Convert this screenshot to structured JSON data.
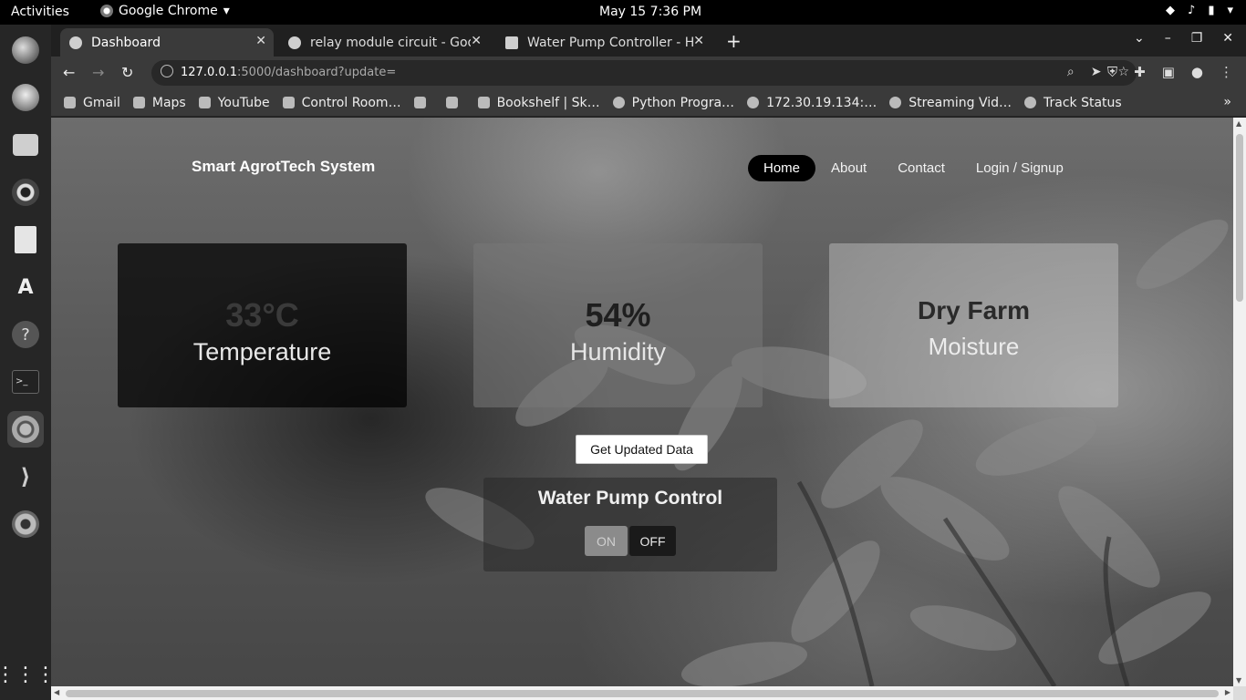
{
  "topbar": {
    "activities": "Activities",
    "app_name": "Google Chrome",
    "datetime": "May 15  7:36 PM"
  },
  "dock": {
    "items": [
      "firefox-icon",
      "thunderbird-icon",
      "files-icon",
      "rhythmbox-icon",
      "writer-icon",
      "software-icon",
      "help-icon",
      "terminal-icon",
      "chrome-icon",
      "vscode-icon",
      "settings-icon",
      "apps-grid-icon"
    ]
  },
  "tabs": [
    {
      "title": "Dashboard",
      "active": true
    },
    {
      "title": "relay module circuit - Goog",
      "active": false
    },
    {
      "title": "Water Pump Controller - H",
      "active": false
    }
  ],
  "address": {
    "host": "127.0.0.1",
    "path": ":5000/dashboard?update="
  },
  "bookmarks": [
    "Gmail",
    "Maps",
    "YouTube",
    "Control Room…",
    "",
    "",
    "Bookshelf | Sk…",
    "Python Progra…",
    "172.30.19.134:…",
    "Streaming Vid…",
    "Track Status"
  ],
  "page": {
    "brand": "Smart AgrotTech System",
    "nav": [
      "Home",
      "About",
      "Contact",
      "Login / Signup"
    ],
    "temperature": {
      "value": "33°C",
      "label": "Temperature"
    },
    "humidity": {
      "value": "54%",
      "label": "Humidity"
    },
    "moisture": {
      "value": "Dry Farm",
      "label": "Moisture"
    },
    "update_button": "Get Updated Data",
    "pump": {
      "title": "Water Pump Control",
      "on": "ON",
      "off": "OFF"
    }
  }
}
